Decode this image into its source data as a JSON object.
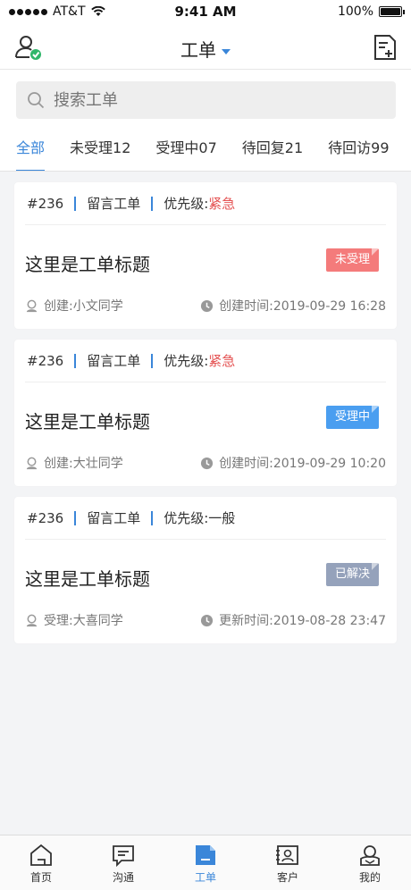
{
  "status_bar": {
    "carrier": "AT&T",
    "time": "9:41 AM",
    "battery": "100%",
    "battery_level": 1.0
  },
  "nav": {
    "title": "工单",
    "left_icon": "user-check-icon",
    "right_icon": "add-document-icon"
  },
  "search": {
    "placeholder": "搜索工单",
    "value": ""
  },
  "tabs": [
    {
      "label": "全部",
      "active": true
    },
    {
      "label": "未受理12",
      "active": false
    },
    {
      "label": "受理中07",
      "active": false
    },
    {
      "label": "待回复21",
      "active": false
    },
    {
      "label": "待回访99",
      "active": false
    }
  ],
  "tickets": [
    {
      "id": "#236",
      "type": "留言工单",
      "priority_label": "优先级:",
      "priority": "紧急",
      "title": "这里是工单标题",
      "status": "未受理",
      "status_color": "#f47b7b",
      "person": "创建:小文同学",
      "time": "创建时间:2019-09-29 16:28"
    },
    {
      "id": "#236",
      "type": "留言工单",
      "priority_label": "优先级:",
      "priority": "紧急",
      "title": "这里是工单标题",
      "status": "受理中",
      "status_color": "#4a9ef0",
      "person": "创建:大壮同学",
      "time": "创建时间:2019-09-29 10:20"
    },
    {
      "id": "#236",
      "type": "留言工单",
      "priority_label": "优先级:",
      "priority": "一般",
      "title": "这里是工单标题",
      "status": "已解决",
      "status_color": "#95a2bb",
      "person": "受理:大喜同学",
      "time": "更新时间:2019-08-28 23:47"
    }
  ],
  "bottom_tabs": [
    {
      "label": "首页",
      "icon": "home-icon",
      "active": false
    },
    {
      "label": "沟通",
      "icon": "chat-icon",
      "active": false
    },
    {
      "label": "工单",
      "icon": "ticket-icon",
      "active": true
    },
    {
      "label": "客户",
      "icon": "contact-card-icon",
      "active": false
    },
    {
      "label": "我的",
      "icon": "profile-icon",
      "active": false
    }
  ],
  "colors": {
    "accent": "#3a86d9",
    "urgent": "#e45252"
  }
}
